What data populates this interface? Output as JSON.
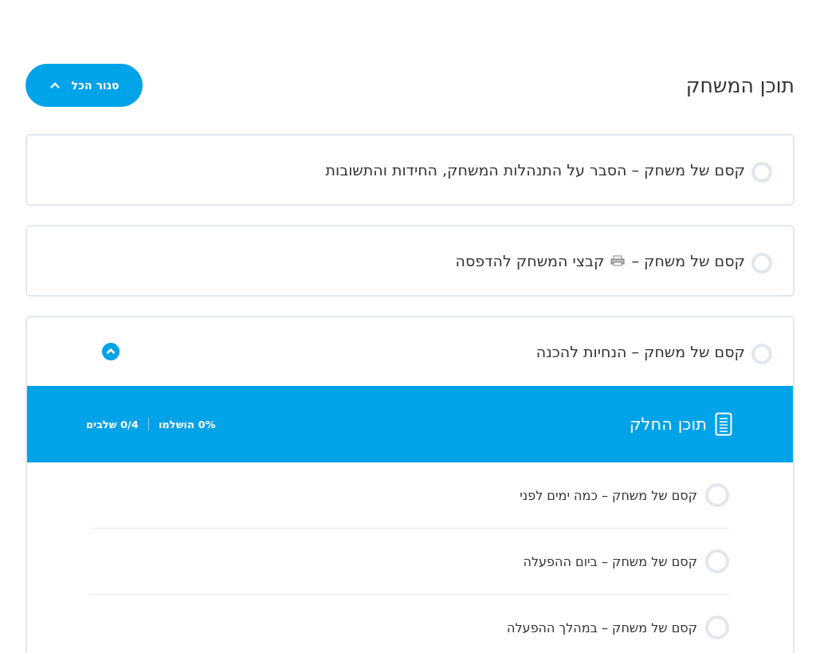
{
  "header": {
    "title": "תוכן המשחק",
    "collapse_button": "סגור הכל"
  },
  "sections": [
    {
      "title": [
        "קסם של משחק – הסבר על התנהלות המשחק, החידות והתשובות"
      ],
      "completed": false,
      "expanded": false
    },
    {
      "title": [
        "קסם של משחק –",
        "קבצי המשחק להדפסה"
      ],
      "completed": false,
      "expanded": false
    },
    {
      "title": [
        "קסם של משחק – הנחיות להכנה"
      ],
      "completed": false,
      "expanded": true,
      "content": {
        "heading": "תוכן החלק",
        "progress": "0% הושלמו",
        "steps": "0/4 שלבים",
        "lessons": [
          {
            "title": "קסם של משחק – כמה ימים לפני",
            "completed": false
          },
          {
            "title": "קסם של משחק – ביום ההפעלה",
            "completed": false
          },
          {
            "title": "קסם של משחק – במהלך ההפעלה",
            "completed": false
          }
        ]
      }
    }
  ]
}
